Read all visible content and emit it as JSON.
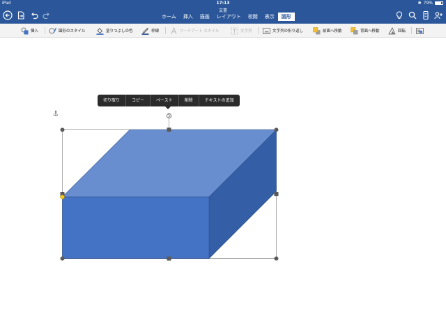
{
  "status": {
    "device": "iPad",
    "time": "17:13",
    "battery": "79%"
  },
  "document": {
    "title": "文書"
  },
  "tabs": [
    "ホーム",
    "挿入",
    "描画",
    "レイアウト",
    "校閲",
    "表示",
    "図形"
  ],
  "ribbon": {
    "insert": "挿入",
    "shape_styles": "図形のスタイル",
    "fill_color": "塗りつぶしの色",
    "outline": "枠線",
    "wordart_styles": "ワードアート スタイル",
    "text_box": "文字列",
    "wrap_text": "文字列の折り返し",
    "bring_forward": "前面へ移動",
    "send_backward": "背面へ移動",
    "rotate": "回転"
  },
  "context_menu": [
    "切り取り",
    "コピー",
    "ペースト",
    "削除",
    "テキストの追加"
  ],
  "colors": {
    "title_bar": "#2b579a",
    "shape_front": "#4472c4",
    "shape_top": "#698ed0",
    "shape_side": "#345ea5",
    "fill_swatch": "#4472c4",
    "outline_swatch": "#2f528f",
    "adjust_handle": "#f5c518"
  },
  "icons": [
    "back-icon",
    "file-icon",
    "undo-icon",
    "redo-icon",
    "lightbulb-icon",
    "search-icon",
    "phone-icon",
    "share-user-icon",
    "anchor-icon",
    "rotate-handle-icon"
  ]
}
